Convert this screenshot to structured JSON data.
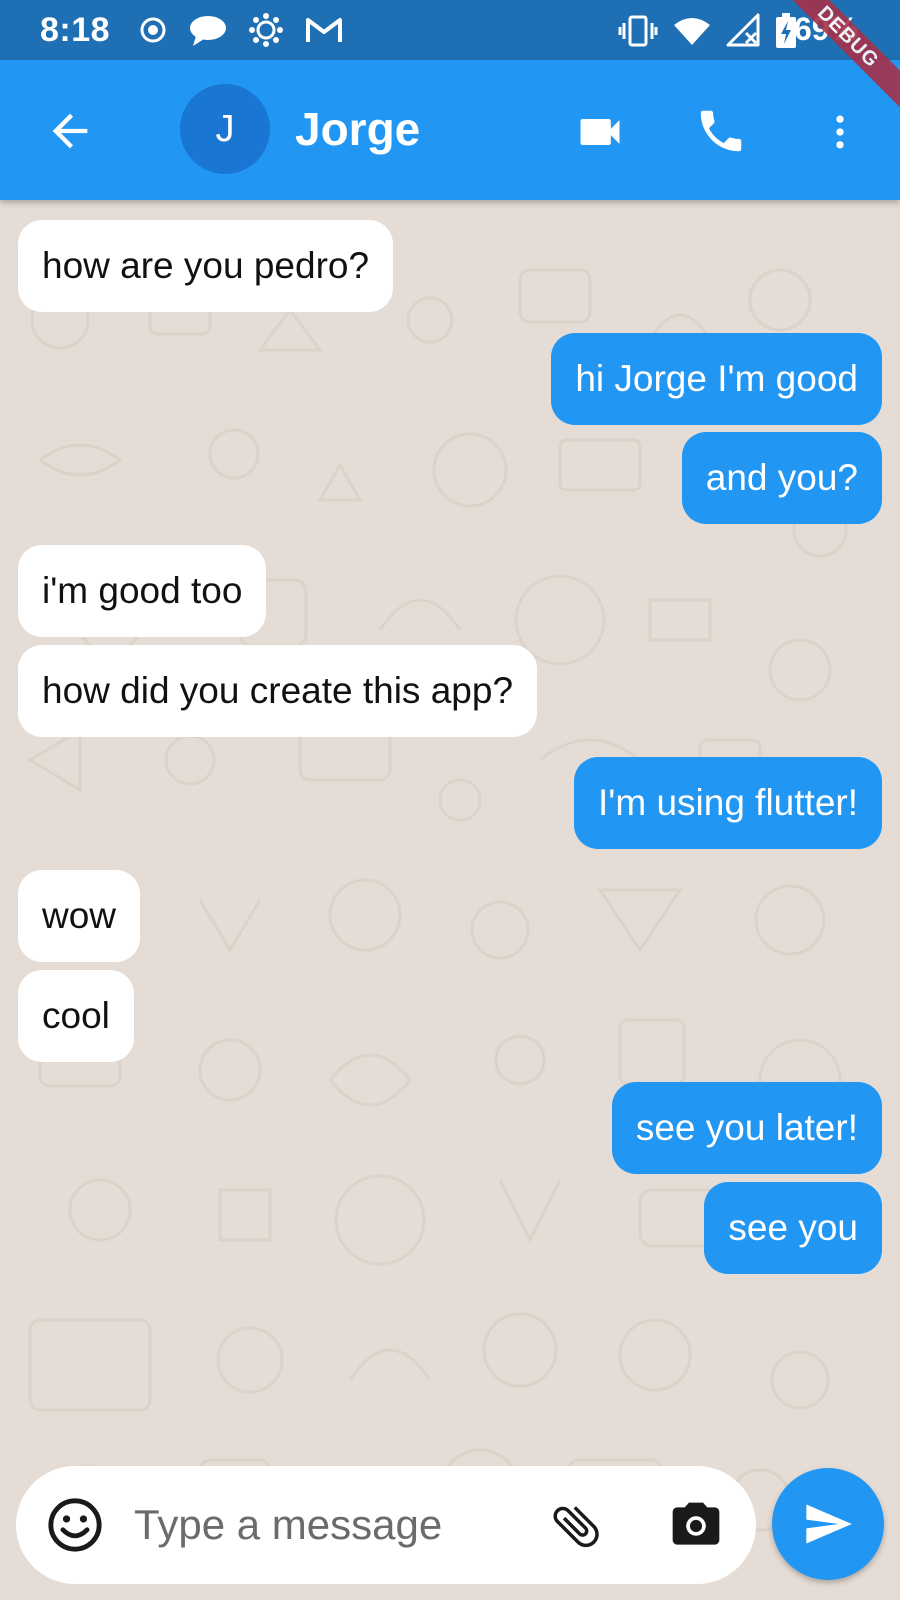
{
  "status_bar": {
    "time": "8:18",
    "battery": "69%",
    "left_icons": [
      "record-icon",
      "chat-icon",
      "canvas-icon",
      "gmail-icon"
    ],
    "right_icons": [
      "vibrate-icon",
      "wifi-icon",
      "signal-icon",
      "battery-charging-icon"
    ]
  },
  "debug_banner": "DEBUG",
  "header": {
    "avatar_letter": "J",
    "contact_name": "Jorge",
    "icons": [
      "back-arrow-icon",
      "videocam-icon",
      "phone-icon",
      "more-vert-icon"
    ]
  },
  "messages": [
    {
      "from": "them",
      "text": "how are you pedro?"
    },
    {
      "from": "me",
      "text": "hi Jorge I'm good"
    },
    {
      "from": "me",
      "text": "and you?"
    },
    {
      "from": "them",
      "text": "i'm good too"
    },
    {
      "from": "them",
      "text": "how did you create this app?"
    },
    {
      "from": "me",
      "text": "I'm using flutter!"
    },
    {
      "from": "them",
      "text": "wow"
    },
    {
      "from": "them",
      "text": "cool"
    },
    {
      "from": "me",
      "text": "see you later!"
    },
    {
      "from": "me",
      "text": "see you"
    }
  ],
  "composer": {
    "placeholder": "Type a message",
    "value": "",
    "icons": [
      "emoji-icon",
      "attach-icon",
      "camera-icon",
      "send-icon"
    ]
  },
  "colors": {
    "primary": "#2196f3",
    "status_bar": "#1f6fb4",
    "avatar": "#1976d2",
    "chat_background": "#e5ddd5",
    "incoming_bubble": "#ffffff",
    "outgoing_bubble": "#2196f3",
    "debug_ribbon": "#a5324a"
  }
}
